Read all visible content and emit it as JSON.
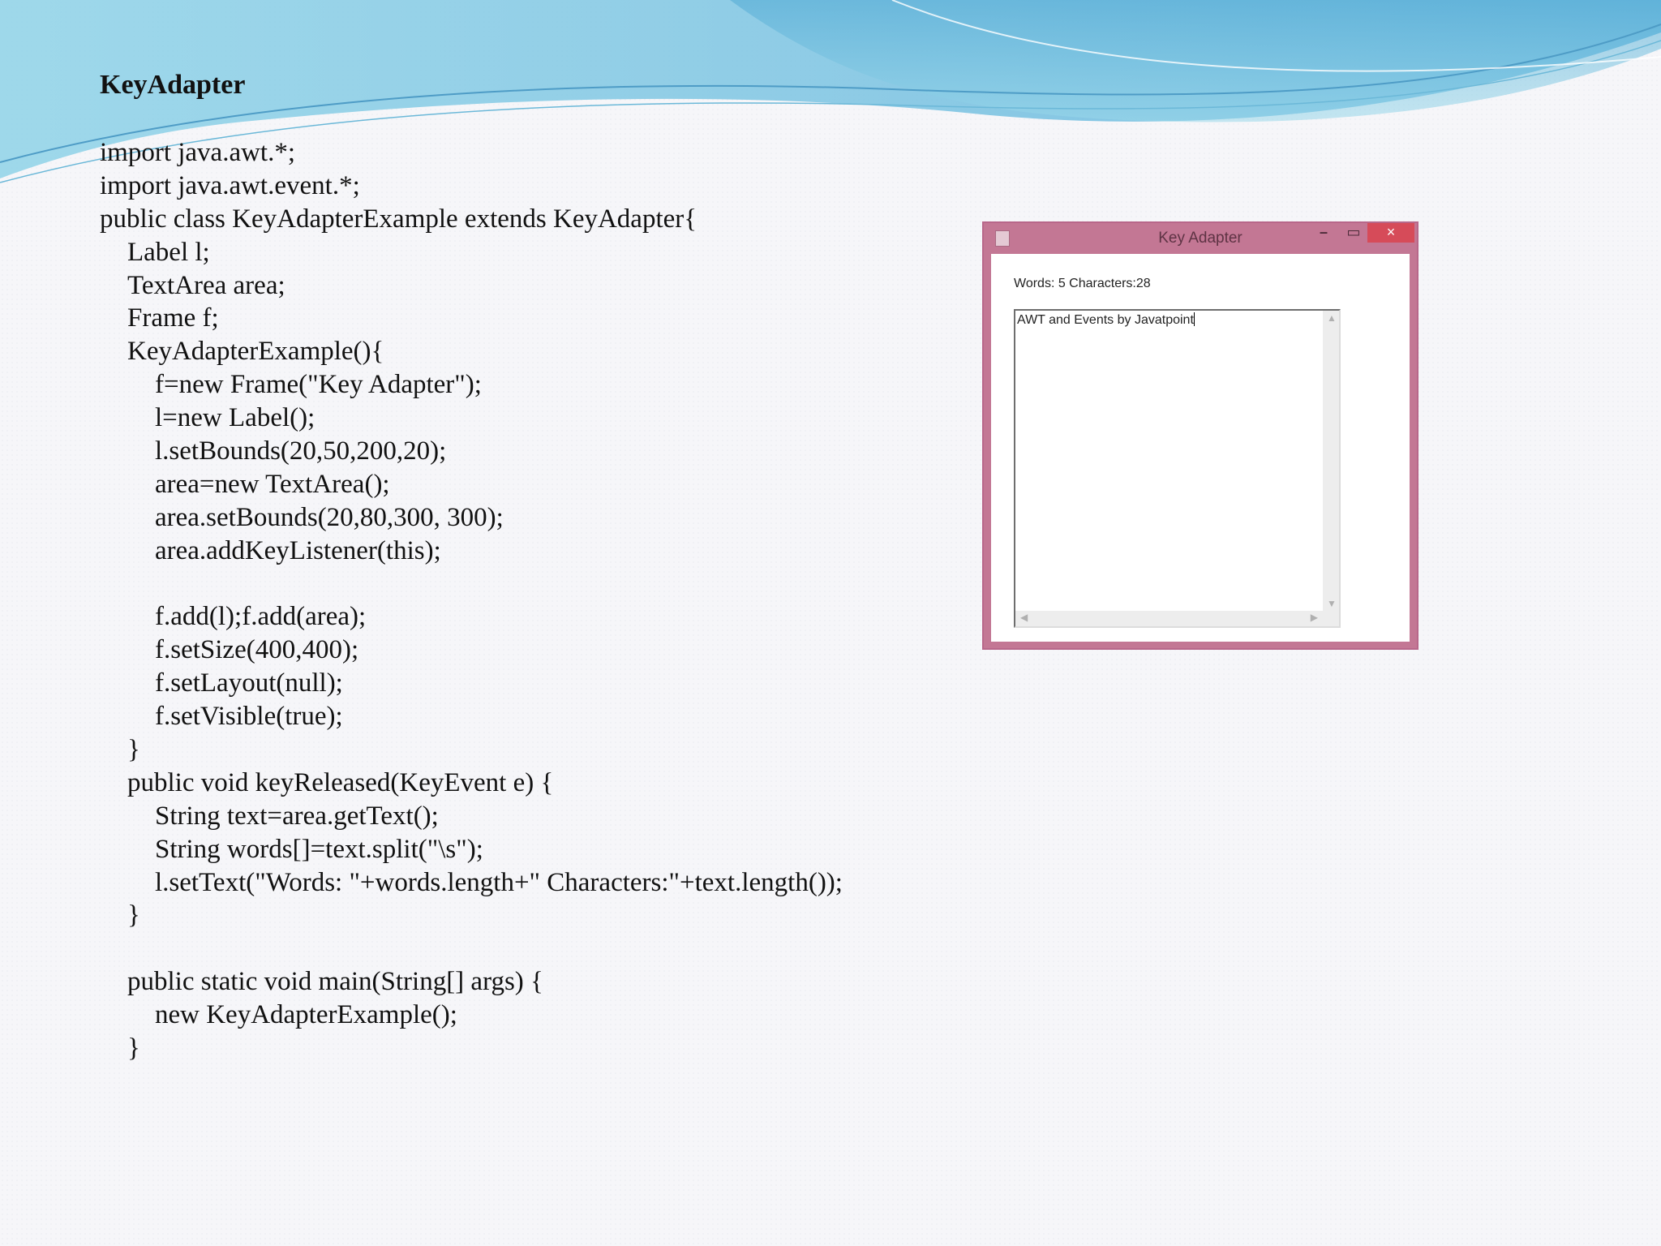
{
  "slide": {
    "title": "KeyAdapter",
    "code_lines": [
      {
        "indent": 0,
        "text": "import java.awt.*;"
      },
      {
        "indent": 0,
        "text": "import java.awt.event.*;"
      },
      {
        "indent": 0,
        "text": "public class KeyAdapterExample extends KeyAdapter{"
      },
      {
        "indent": 1,
        "text": "Label l;"
      },
      {
        "indent": 1,
        "text": "TextArea area;"
      },
      {
        "indent": 1,
        "text": "Frame f;"
      },
      {
        "indent": 1,
        "text": "KeyAdapterExample(){"
      },
      {
        "indent": 2,
        "text": "f=new Frame(\"Key Adapter\");"
      },
      {
        "indent": 2,
        "text": "l=new Label();"
      },
      {
        "indent": 2,
        "text": "l.setBounds(20,50,200,20);"
      },
      {
        "indent": 2,
        "text": "area=new TextArea();"
      },
      {
        "indent": 2,
        "text": "area.setBounds(20,80,300, 300);"
      },
      {
        "indent": 2,
        "text": "area.addKeyListener(this);"
      },
      {
        "indent": 2,
        "text": ""
      },
      {
        "indent": 2,
        "text": "f.add(l);f.add(area);"
      },
      {
        "indent": 2,
        "text": "f.setSize(400,400);"
      },
      {
        "indent": 2,
        "text": "f.setLayout(null);"
      },
      {
        "indent": 2,
        "text": "f.setVisible(true);"
      },
      {
        "indent": 1,
        "text": "}"
      },
      {
        "indent": 1,
        "text": "public void keyReleased(KeyEvent e) {"
      },
      {
        "indent": 2,
        "text": "String text=area.getText();"
      },
      {
        "indent": 2,
        "text": "String words[]=text.split(\"\\s\");"
      },
      {
        "indent": 2,
        "text": "l.setText(\"Words: \"+words.length+\" Characters:\"+text.length());"
      },
      {
        "indent": 1,
        "text": "}"
      },
      {
        "indent": 1,
        "text": ""
      },
      {
        "indent": 1,
        "text": "public static void main(String[] args) {"
      },
      {
        "indent": 2,
        "text": "new KeyAdapterExample();"
      },
      {
        "indent": 1,
        "text": "}"
      }
    ]
  },
  "window": {
    "title": "Key Adapter",
    "minimize_glyph": "–",
    "maximize_glyph": "▭",
    "close_glyph": "×",
    "label_text": "Words: 5 Characters:28",
    "textarea_value": "AWT and Events by Javatpoint",
    "icons": {
      "app": "java-app-icon",
      "up": "▲",
      "down": "▼",
      "left": "◀",
      "right": "▶"
    }
  },
  "colors": {
    "window_frame": "#c37794",
    "close_button": "#d64b59",
    "wave_light": "#b8e3f0",
    "wave_dark": "#5ab7d6"
  }
}
